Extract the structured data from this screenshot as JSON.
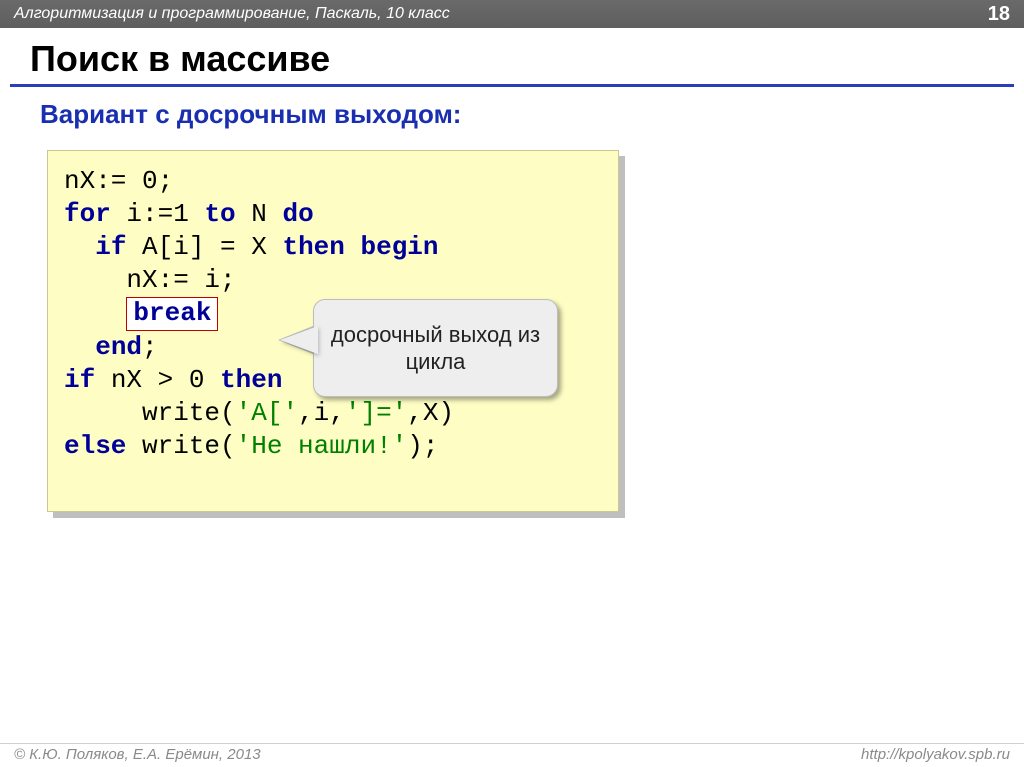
{
  "header": {
    "breadcrumb": "Алгоритмизация и программирование, Паскаль, 10 класс",
    "page_number": "18"
  },
  "title": "Поиск в массиве",
  "subtitle": "Вариант с досрочным выходом:",
  "code": {
    "l1_a": "nX:= ",
    "l1_num": "0",
    "l1_b": ";",
    "l2_kw1": "for",
    "l2_a": " i:=",
    "l2_num": "1",
    "l2_b": " ",
    "l2_kw2": "to",
    "l2_c": " N ",
    "l2_kw3": "do",
    "l3_pad": "  ",
    "l3_kw1": "if",
    "l3_a": " A[i] = X ",
    "l3_kw2": "then",
    "l3_b": " ",
    "l3_kw3": "begin",
    "l4_pad": "    ",
    "l4_a": "nX:= i;",
    "l5_pad": "    ",
    "l5_break": "break",
    "l6_pad": "  ",
    "l6_kw": "end",
    "l6_a": ";",
    "l7_kw": "if",
    "l7_a": " nX > ",
    "l7_num": "0",
    "l7_b": " ",
    "l7_kw2": "then",
    "l8_pad": "     ",
    "l8_fn": "write(",
    "l8_s1": "'A['",
    "l8_a": ",i,",
    "l8_s2": "']='",
    "l8_b": ",X)",
    "l9_kw": "else",
    "l9_a": " write(",
    "l9_s": "'Не нашли!'",
    "l9_b": ");"
  },
  "callout": "досрочный выход из цикла",
  "footer": {
    "left": "© К.Ю. Поляков, Е.А. Ерёмин, 2013",
    "right": "http://kpolyakov.spb.ru"
  }
}
